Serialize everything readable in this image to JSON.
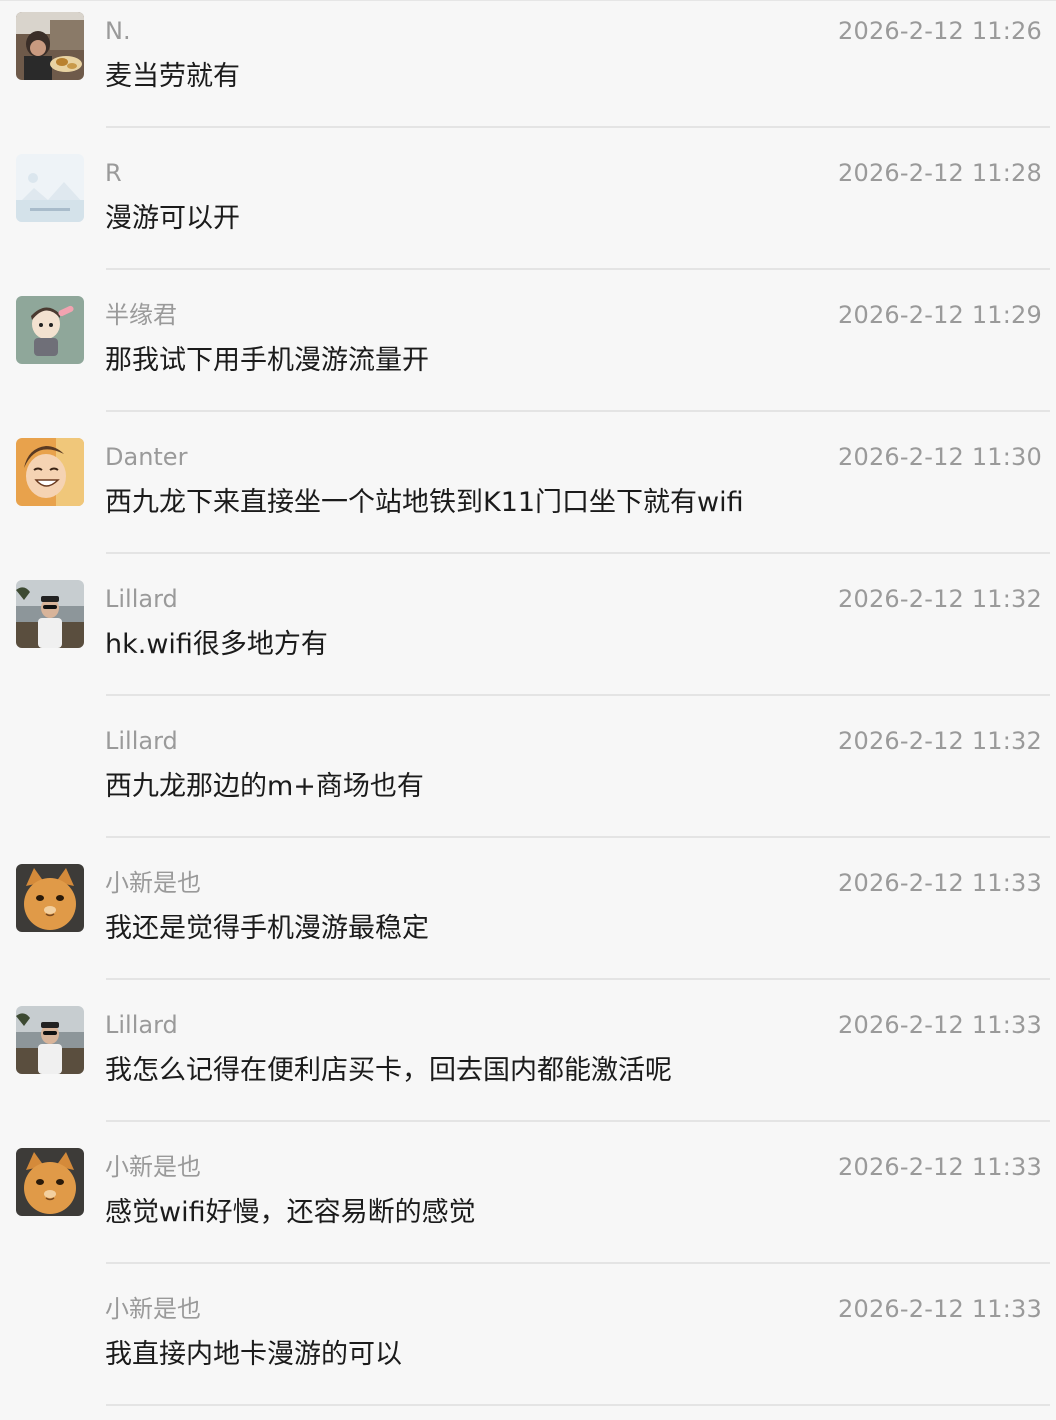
{
  "messages": [
    {
      "name": "N.",
      "time": "2026-2-12 11:26",
      "text": "麦当劳就有",
      "avatar": "photo-avatar-food"
    },
    {
      "name": "R",
      "time": "2026-2-12 11:28",
      "text": "漫游可以开",
      "avatar": "placeholder-image-avatar"
    },
    {
      "name": "半缘君",
      "time": "2026-2-12 11:29",
      "text": "那我试下用手机漫游流量开",
      "avatar": "cartoon-boy-avatar"
    },
    {
      "name": "Danter",
      "time": "2026-2-12 11:30",
      "text": "西九龙下来直接坐一个站地铁到K11门口坐下就有wifi",
      "avatar": "anime-smile-avatar"
    },
    {
      "name": "Lillard",
      "time": "2026-2-12 11:32",
      "text": "hk.wifi很多地方有",
      "avatar": "man-landscape-avatar"
    },
    {
      "name": "Lillard",
      "time": "2026-2-12 11:32",
      "text": "西九龙那边的m+商场也有",
      "avatar": ""
    },
    {
      "name": "小新是也",
      "time": "2026-2-12 11:33",
      "text": "我还是觉得手机漫游最稳定",
      "avatar": "orange-cat-avatar"
    },
    {
      "name": "Lillard",
      "time": "2026-2-12 11:33",
      "text": "我怎么记得在便利店买卡，回去国内都能激活呢",
      "avatar": "man-landscape-avatar"
    },
    {
      "name": "小新是也",
      "time": "2026-2-12 11:33",
      "text": "感觉wifi好慢，还容易断的感觉",
      "avatar": "orange-cat-avatar"
    },
    {
      "name": "小新是也",
      "time": "2026-2-12 11:33",
      "text": "我直接内地卡漫游的可以",
      "avatar": ""
    }
  ]
}
